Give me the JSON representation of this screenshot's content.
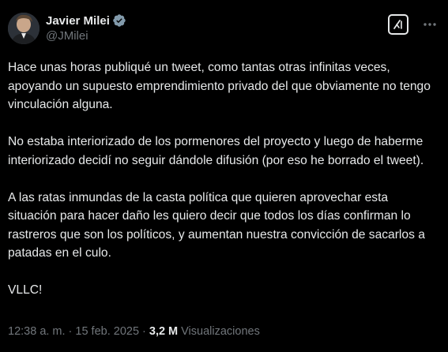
{
  "author": {
    "display_name": "Javier Milei",
    "handle": "@JMilei",
    "verified_icon": "verified-badge-icon",
    "verified_color": "#829aab"
  },
  "actions": {
    "grok_icon": "grok-icon",
    "more_icon": "more-options-icon"
  },
  "tweet": {
    "paragraphs": [
      "Hace unas horas publiqué un tweet, como tantas otras infinitas veces, apoyando un supuesto emprendimiento privado del que obviamente no tengo vinculación alguna.",
      "No estaba interiorizado de los pormenores del proyecto y luego de haberme interiorizado decidí no seguir dándole difusión (por eso he borrado el tweet).",
      "A las ratas inmundas de la casta política que quieren aprovechar esta situación para hacer daño les quiero decir que todos los días confirman lo rastreros que son los políticos, y aumentan nuestra convicción de sacarlos a patadas en el culo.",
      "VLLC!"
    ]
  },
  "meta": {
    "time": "12:38 a. m.",
    "separator": "·",
    "date": "15 feb. 2025",
    "views_count": "3,2 M",
    "views_label": "Visualizaciones"
  },
  "colors": {
    "background": "#000000",
    "text": "#e7e9ea",
    "secondary": "#71767b"
  }
}
